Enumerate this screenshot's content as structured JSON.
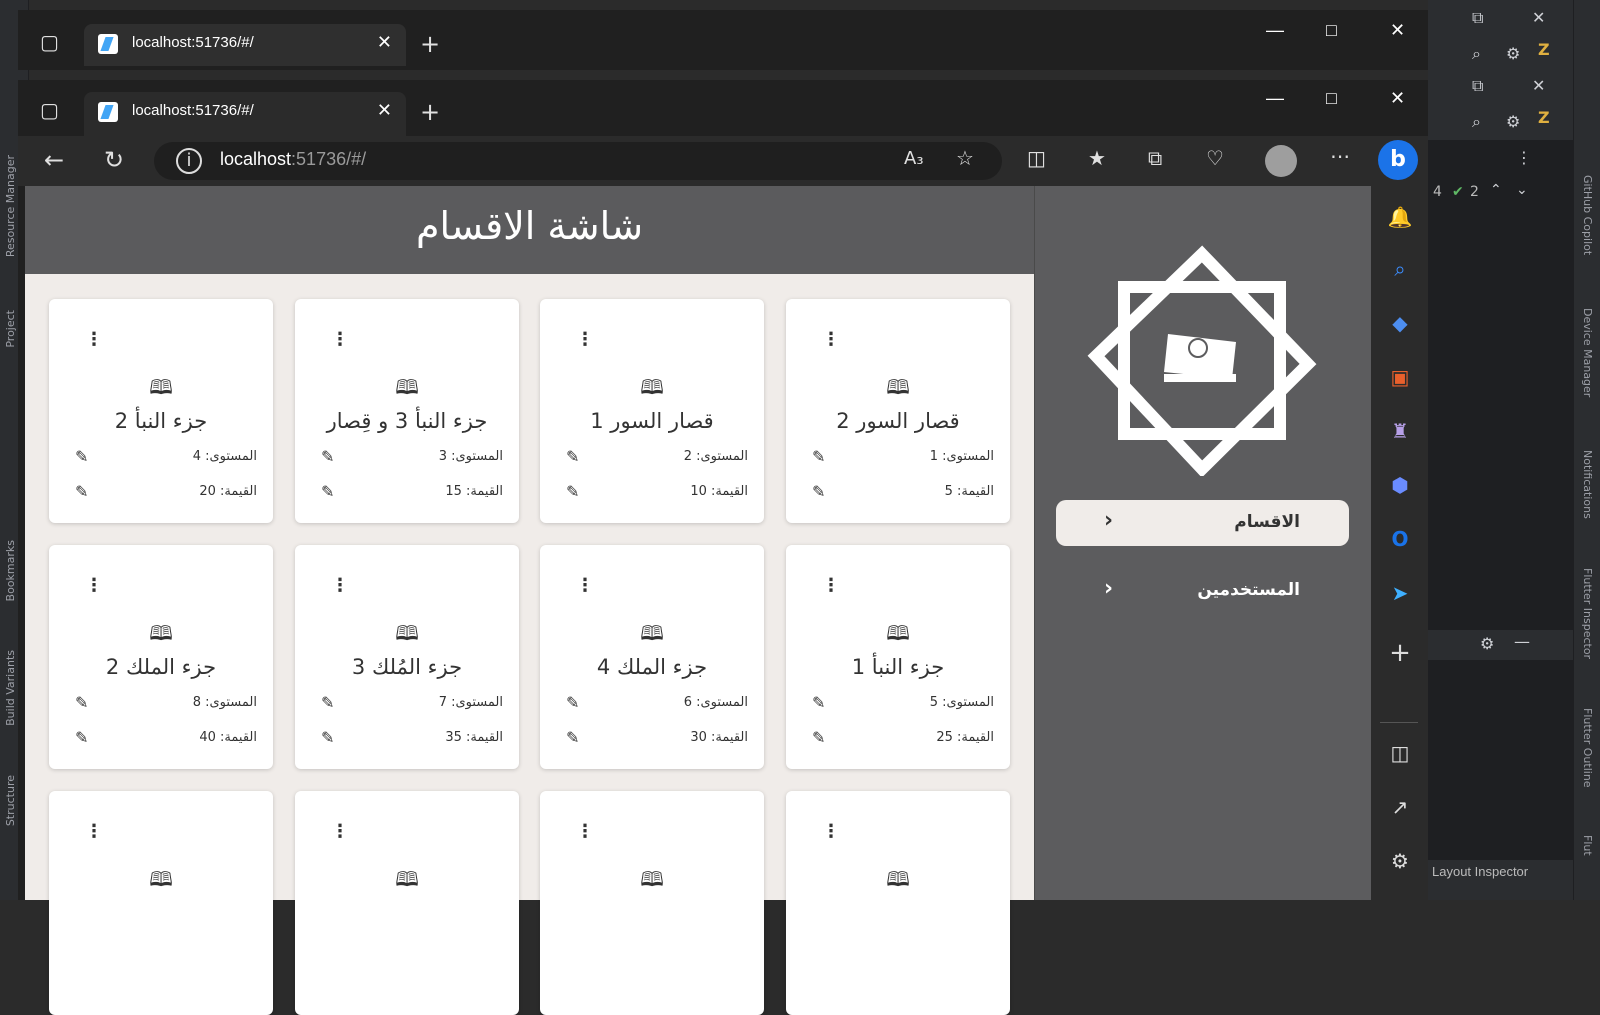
{
  "browser": {
    "tab_title": "localhost:51736/#/",
    "url_host": "localhost",
    "url_rest": ":51736/#/"
  },
  "app": {
    "title": "شاشة الاقسام",
    "drawer": {
      "items": [
        {
          "label": "الاقسام",
          "selected": true
        },
        {
          "label": "المستخدمين",
          "selected": false
        }
      ]
    },
    "cards": [
      {
        "name": "قصار السور 2",
        "level": "المستوى: 1",
        "value": "القيمة: 5"
      },
      {
        "name": "قصار السور 1",
        "level": "المستوى: 2",
        "value": "القيمة: 10"
      },
      {
        "name": "جزء النبأ 3 و قِصار",
        "level": "المستوى: 3",
        "value": "القيمة: 15"
      },
      {
        "name": "جزء النبأ 2",
        "level": "المستوى: 4",
        "value": "القيمة: 20"
      },
      {
        "name": "جزء النبأ 1",
        "level": "المستوى: 5",
        "value": "القيمة: 25"
      },
      {
        "name": "جزء الملك 4",
        "level": "المستوى: 6",
        "value": "القيمة: 30"
      },
      {
        "name": "جزء المُلك 3",
        "level": "المستوى: 7",
        "value": "القيمة: 35"
      },
      {
        "name": "جزء الملك 2",
        "level": "المستوى: 8",
        "value": "القيمة: 40"
      }
    ]
  },
  "ide": {
    "left_labels": [
      "Resource Manager",
      "Project",
      "Bookmarks",
      "Build Variants",
      "Structure"
    ],
    "right_labels": [
      "GitHub Copilot",
      "Device Manager",
      "Notifications",
      "Flutter Inspector",
      "Flutter Outline",
      "Flut"
    ],
    "inspection_count": "4",
    "check_count": "2",
    "bottom_label": "Layout Inspector"
  },
  "colors": {
    "header": "#5b5b5d",
    "drawer": "#5c5c5e",
    "background": "#f0ece9",
    "card": "#ffffff"
  }
}
